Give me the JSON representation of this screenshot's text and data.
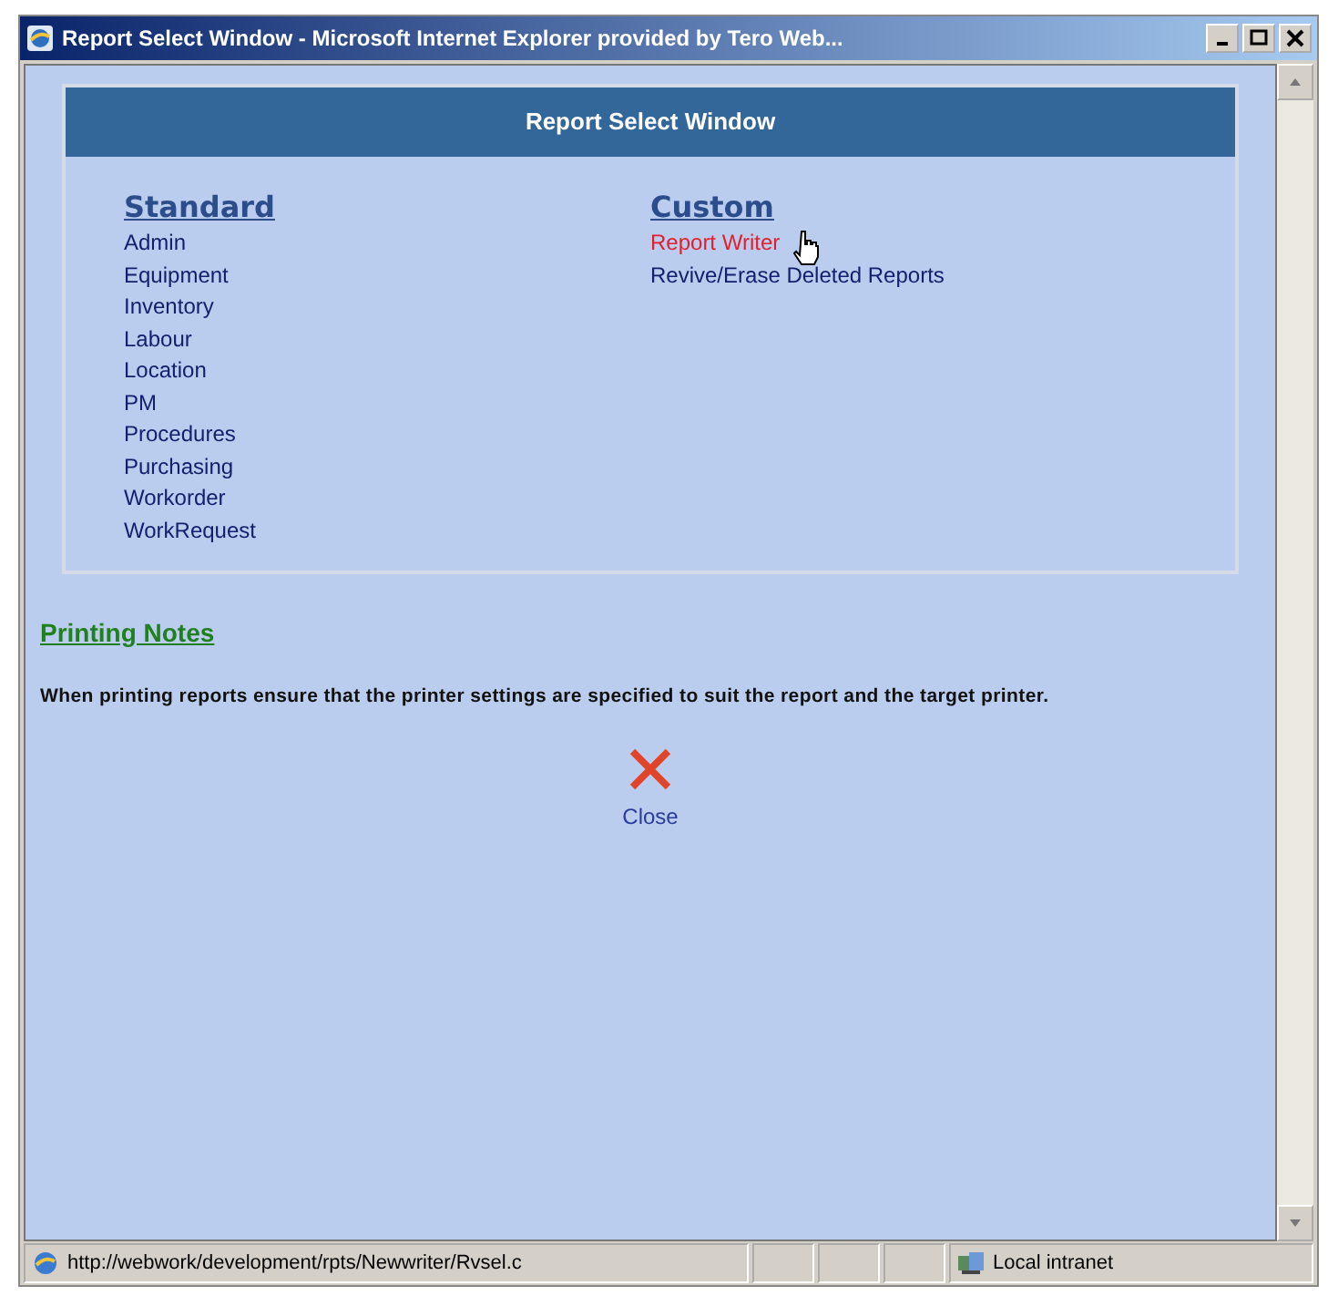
{
  "window": {
    "title": "Report Select Window - Microsoft Internet Explorer provided by Tero Web..."
  },
  "header": {
    "title": "Report Select Window"
  },
  "sections": [
    {
      "heading": "Standard",
      "links": [
        {
          "label": "Admin",
          "hovered": false
        },
        {
          "label": "Equipment",
          "hovered": false
        },
        {
          "label": "Inventory",
          "hovered": false
        },
        {
          "label": "Labour",
          "hovered": false
        },
        {
          "label": "Location",
          "hovered": false
        },
        {
          "label": "PM",
          "hovered": false
        },
        {
          "label": "Procedures",
          "hovered": false
        },
        {
          "label": "Purchasing",
          "hovered": false
        },
        {
          "label": "Workorder",
          "hovered": false
        },
        {
          "label": "WorkRequest",
          "hovered": false
        }
      ]
    },
    {
      "heading": "Custom",
      "links": [
        {
          "label": "Report Writer",
          "hovered": true
        },
        {
          "label": "Revive/Erase Deleted Reports",
          "hovered": false
        }
      ]
    }
  ],
  "notes": {
    "heading": "Printing Notes",
    "text": "When printing reports ensure that the printer settings are specified to suit the report and the target printer."
  },
  "close": {
    "label": "Close"
  },
  "status_bar": {
    "url": "http://webwork/development/rpts/Newwriter/Rvsel.c",
    "zone": "Local intranet"
  }
}
